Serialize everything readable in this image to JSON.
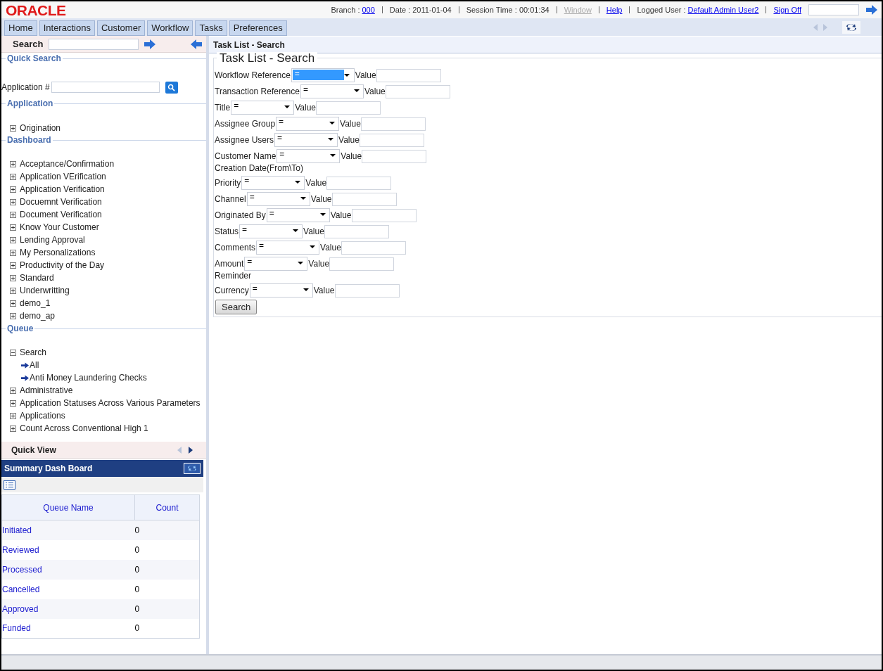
{
  "header": {
    "logo": "ORACLE",
    "branch_label": "Branch :",
    "branch": "000",
    "date": "Date : 2011-01-04",
    "session": "Session Time : 00:01:34",
    "window_link": {
      "label": "Window",
      "disabled": true
    },
    "help": "Help",
    "user_label": "Logged User :",
    "user": "Default Admin User2",
    "sign_off": "Sign Off"
  },
  "tabs": [
    {
      "label": "Home",
      "selected": false
    },
    {
      "label": "Interactions",
      "selected": false
    },
    {
      "label": "Customer",
      "selected": false
    },
    {
      "label": "Workflow",
      "selected": false
    },
    {
      "label": "Tasks",
      "selected": false
    },
    {
      "label": "Preferences",
      "selected": false
    }
  ],
  "sidebar": {
    "search_label": "Search",
    "quick_search": {
      "legend": "Quick Search",
      "field_label": "Application #"
    },
    "application": {
      "legend": "Application",
      "items": [
        {
          "label": "Origination",
          "expanded": false
        }
      ]
    },
    "dashboard": {
      "legend": "Dashboard",
      "items": [
        {
          "label": "Acceptance/Confirmation",
          "expanded": false
        },
        {
          "label": "Application VErification",
          "expanded": false
        },
        {
          "label": "Application Verification",
          "expanded": false
        },
        {
          "label": "Docuemnt Verification",
          "expanded": false
        },
        {
          "label": "Document Verification",
          "expanded": false
        },
        {
          "label": "Know Your Customer",
          "expanded": false
        },
        {
          "label": "Lending Approval",
          "expanded": false
        },
        {
          "label": "My Personalizations",
          "expanded": false
        },
        {
          "label": "Productivity of the Day",
          "expanded": false
        },
        {
          "label": "Standard",
          "expanded": false
        },
        {
          "label": "Underwritting",
          "expanded": false
        },
        {
          "label": "demo_1",
          "expanded": false
        },
        {
          "label": "demo_ap",
          "expanded": false
        }
      ]
    },
    "queue": {
      "legend": "Queue",
      "items": [
        {
          "label": "Search",
          "expanded": true,
          "children": [
            {
              "label": "All"
            },
            {
              "label": "Anti Money Laundering Checks"
            }
          ]
        },
        {
          "label": "Administrative",
          "expanded": false
        },
        {
          "label": "Application Statuses Across Various Parameters",
          "expanded": false
        },
        {
          "label": "Applications",
          "expanded": false
        },
        {
          "label": "Count Across Conventional High 1",
          "expanded": false
        }
      ]
    },
    "quick_view": "Quick View",
    "summary": {
      "title": "Summary Dash Board",
      "columns": [
        "Queue Name",
        "Count"
      ],
      "rows": [
        [
          "Initiated",
          "0"
        ],
        [
          "Reviewed",
          "0"
        ],
        [
          "Processed",
          "0"
        ],
        [
          "Cancelled",
          "0"
        ],
        [
          "Approved",
          "0"
        ],
        [
          "Funded",
          "0"
        ]
      ]
    }
  },
  "main": {
    "header": "Task List - Search",
    "legend": "Task List - Search",
    "fields": [
      {
        "kind": "filter",
        "label": "Workflow Reference",
        "operator": "=",
        "focused": true,
        "value_label": "Value"
      },
      {
        "kind": "filter",
        "label": "Transaction Reference",
        "operator": "=",
        "focused": false,
        "value_label": "Value"
      },
      {
        "kind": "filter",
        "label": "Title",
        "operator": "=",
        "focused": false,
        "value_label": "Value"
      },
      {
        "kind": "filter",
        "label": "Assignee Group",
        "operator": "=",
        "focused": false,
        "value_label": "Value"
      },
      {
        "kind": "filter",
        "label": "Assignee Users",
        "operator": "=",
        "focused": false,
        "value_label": "Value"
      },
      {
        "kind": "filter",
        "label": "Customer Name",
        "operator": "=",
        "focused": false,
        "value_label": "Value"
      },
      {
        "kind": "heading",
        "label": "Creation Date(From\\To)"
      },
      {
        "kind": "filter",
        "label": "Priority",
        "operator": "=",
        "focused": false,
        "value_label": "Value"
      },
      {
        "kind": "filter",
        "label": "Channel",
        "operator": "=",
        "focused": false,
        "value_label": "Value"
      },
      {
        "kind": "filter",
        "label": "Originated By",
        "operator": "=",
        "focused": false,
        "value_label": "Value"
      },
      {
        "kind": "filter",
        "label": "Status",
        "operator": "=",
        "focused": false,
        "value_label": "Value"
      },
      {
        "kind": "filter",
        "label": "Comments",
        "operator": "=",
        "focused": false,
        "value_label": "Value"
      },
      {
        "kind": "filter",
        "label": "Amount",
        "operator": "=",
        "focused": false,
        "value_label": "Value"
      },
      {
        "kind": "heading",
        "label": "Reminder"
      },
      {
        "kind": "filter",
        "label": "Currency",
        "operator": "=",
        "focused": false,
        "value_label": "Value"
      }
    ],
    "button": "Search"
  }
}
